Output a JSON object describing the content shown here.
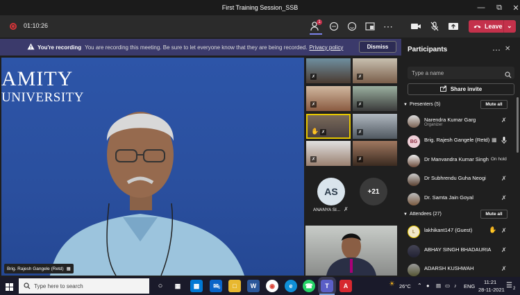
{
  "window": {
    "title": "First Training Session_SSB"
  },
  "toolbar": {
    "timer": "01:10:26",
    "participants_badge": "1",
    "leave_label": "Leave"
  },
  "banner": {
    "heading": "You're recording",
    "message": "You are recording this meeting. Be sure to let everyone know that they are being recorded.",
    "link": "Privacy policy",
    "dismiss": "Dismiss"
  },
  "stage": {
    "logo_line1": "AMITY",
    "logo_line2": "UNIVERSITY",
    "speaker_name": "Brig. Rajesh Gangele (Retd)"
  },
  "gallery": {
    "avatar_initials": "AS",
    "avatar_name": "ANANYA SI...",
    "overflow_count": "+21"
  },
  "panel": {
    "title": "Participants",
    "search_placeholder": "Type a name",
    "share_invite": "Share invite",
    "presenters_label": "Presenters (5)",
    "attendees_label": "Attendees (27)",
    "mute_all": "Mute all",
    "presenters": [
      {
        "name": "Narendra Kumar Garg",
        "role": "Organizer"
      },
      {
        "name": "Brig. Rajesh Gangele (Retd)",
        "initials": "BG"
      },
      {
        "name": "Dr Manvandra Kumar Singh",
        "status": "On hold"
      },
      {
        "name": "Dr Subhrendu Guha Neogi"
      },
      {
        "name": "Dr. Samta Jain Goyal"
      }
    ],
    "attendees": [
      {
        "name": "lakhikant147 (Guest)",
        "initials": "L"
      },
      {
        "name": "ABHAY SINGH BHADAURIA"
      },
      {
        "name": "ADARSH KUSHWAH"
      }
    ]
  },
  "taskbar": {
    "search_placeholder": "Type here to search",
    "mail_badge": "6",
    "temperature": "26°C",
    "language": "ENG",
    "time": "11:21",
    "date": "28-11-2021",
    "notif_count": "2"
  }
}
